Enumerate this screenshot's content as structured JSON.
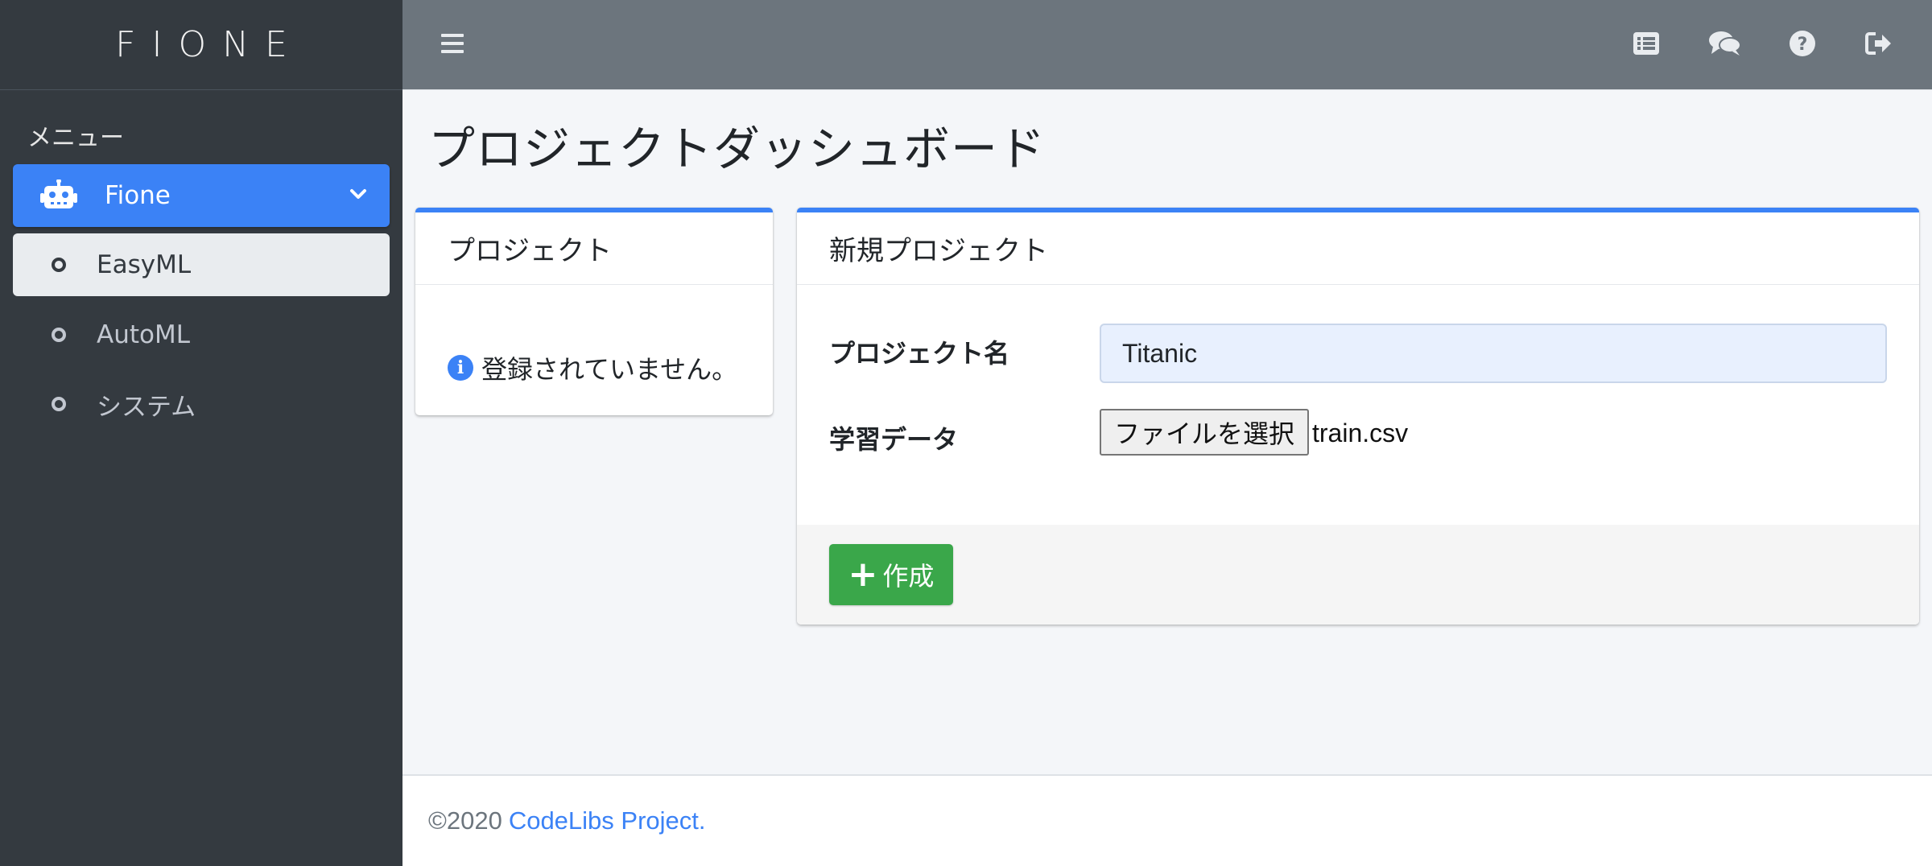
{
  "brand": {
    "logo_text": "FIONE"
  },
  "sidebar": {
    "menu_header": "メニュー",
    "items": [
      {
        "label": "Fione",
        "icon": "robot-icon",
        "active": true
      },
      {
        "label": "EasyML",
        "icon": "circle-icon"
      },
      {
        "label": "AutoML",
        "icon": "circle-icon"
      },
      {
        "label": "システム",
        "icon": "circle-icon"
      }
    ]
  },
  "topbar": {
    "icons": [
      "menu-icon",
      "list-icon",
      "comments-icon",
      "help-icon",
      "logout-icon"
    ]
  },
  "page": {
    "title": "プロジェクトダッシュボード"
  },
  "projects_card": {
    "header": "プロジェクト",
    "empty_message": "登録されていません。"
  },
  "new_project_card": {
    "header": "新規プロジェクト",
    "name_label": "プロジェクト名",
    "name_value": "Titanic",
    "data_label": "学習データ",
    "file_button": "ファイルを選択",
    "file_name": "train.csv",
    "create_button": "作成"
  },
  "footer": {
    "copyright": "©2020",
    "link_text": "CodeLibs Project",
    "trailing": "."
  },
  "colors": {
    "sidebar": "#343a40",
    "topbar": "#6c757d",
    "primary": "#3b82f6",
    "success": "#3aa74a",
    "background": "#f4f6f9"
  }
}
